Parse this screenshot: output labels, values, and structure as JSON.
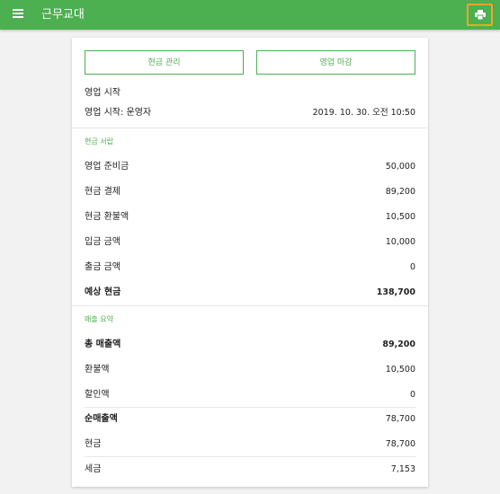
{
  "appbar": {
    "title": "근무교대",
    "menu_icon": "menu-icon",
    "print_icon": "print-icon",
    "print_highlight": "#f5a623",
    "color": "#4caf50"
  },
  "actions": {
    "cash_manage": "현금 관리",
    "close_business": "영업 마감"
  },
  "business_start": {
    "heading": "영업 시작",
    "label": "영업 시작: 운영자",
    "value": "2019. 10. 30. 오전 10:50"
  },
  "cash_statement": {
    "title": "현금 서랍",
    "rows": [
      {
        "label": "영업 준비금",
        "value": "50,000"
      },
      {
        "label": "현금 결제",
        "value": "89,200"
      },
      {
        "label": "현금 환불액",
        "value": "10,500"
      },
      {
        "label": "입금 금액",
        "value": "10,000"
      },
      {
        "label": "출금 금액",
        "value": "0"
      },
      {
        "label": "예상 현금",
        "value": "138,700"
      }
    ]
  },
  "sales_summary": {
    "title": "매출 요약",
    "rows": [
      {
        "label": "총 매출액",
        "value": "89,200"
      },
      {
        "label": "환불액",
        "value": "10,500"
      },
      {
        "label": "할인액",
        "value": "0"
      },
      {
        "label": "순매출액",
        "value": "78,700"
      },
      {
        "label": "현금",
        "value": "78,700"
      },
      {
        "label": "세금",
        "value": "7,153"
      }
    ]
  }
}
